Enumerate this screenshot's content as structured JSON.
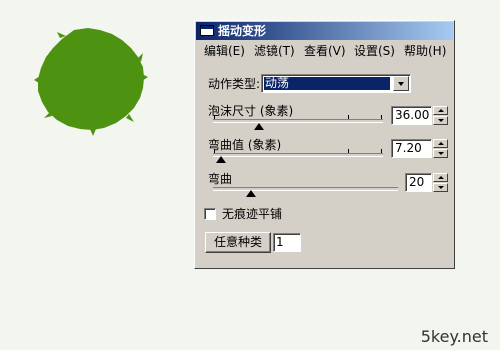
{
  "window": {
    "title": "摇动变形"
  },
  "menu": [
    "编辑(E)",
    "滤镜(T)",
    "查看(V)",
    "设置(S)",
    "帮助(H)"
  ],
  "action_type": {
    "label": "动作类型:",
    "value": "动荡"
  },
  "sliders": [
    {
      "label": "泡沫尺寸 (象素)",
      "value": "36.00"
    },
    {
      "label": "弯曲值 (象素)",
      "value": "7.20"
    },
    {
      "label": "弯曲",
      "value": "20"
    }
  ],
  "seamless": {
    "label": "无痕迹平铺",
    "checked": false
  },
  "random_button": {
    "label": "任意种类"
  },
  "seed_value": "1",
  "watermark": "5key.net",
  "preview_color": "#4e9212"
}
